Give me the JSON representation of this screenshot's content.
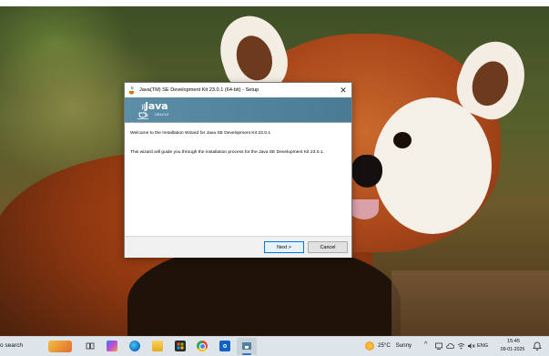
{
  "window": {
    "title": "Java(TM) SE Development Kit 23.0.1 (64-bit) - Setup",
    "close_glyph": "✕",
    "logo_text": "Java",
    "logo_subtext": "ORACLE",
    "welcome_text": "Welcome to the Installation Wizard for Java SE Development Kit 23.0.1",
    "description_text": "This wizard will guide you through the installation process for the Java SE Development Kit 23.0.1.",
    "next_label": "Next >",
    "cancel_label": "Cancel"
  },
  "taskbar": {
    "search_label": "o search",
    "icons": [
      "task-view-icon",
      "copilot-icon",
      "edge-icon",
      "file-explorer-icon",
      "store-icon",
      "chrome-icon",
      "outlook-icon",
      "java-setup-icon"
    ],
    "weather": {
      "temperature": "25°C",
      "condition": "Sunny"
    },
    "tray_expand": "^",
    "language": "ENG",
    "time": "15:45",
    "date": "09-01-2025"
  },
  "colors": {
    "banner": "#4f829c",
    "accent": "#0078d7",
    "taskbar": "#dde4ea"
  }
}
